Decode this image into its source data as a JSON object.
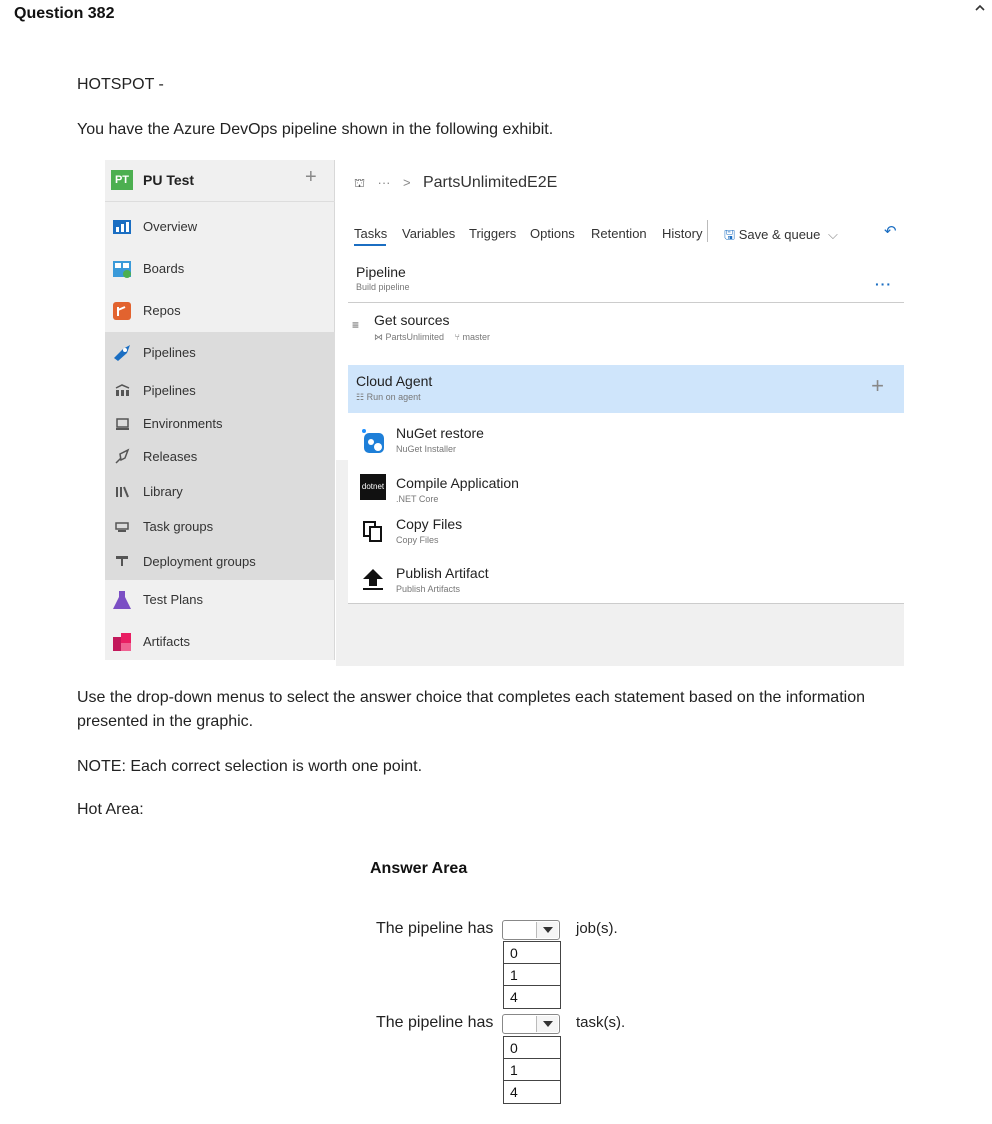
{
  "header": {
    "title": "Question 382",
    "collapse_icon": "chevron-up-icon"
  },
  "body": {
    "hotspot": "HOTSPOT -",
    "intro": "You have the Azure DevOps pipeline shown in the following exhibit.",
    "instructions": "Use the drop-down menus to select the answer choice that completes each statement based on the information presented in the graphic.",
    "note": "NOTE: Each correct selection is worth one point.",
    "hot_area": "Hot Area:"
  },
  "exhibit": {
    "sidebar": {
      "badge": "PT",
      "project": "PU Test",
      "plus": "+",
      "items": [
        {
          "label": "Overview",
          "icon": "overview-icon"
        },
        {
          "label": "Boards",
          "icon": "boards-icon"
        },
        {
          "label": "Repos",
          "icon": "repos-icon"
        },
        {
          "label": "Pipelines",
          "icon": "pipelines-icon"
        },
        {
          "label": "Pipelines",
          "icon": "pipelines-sub-icon"
        },
        {
          "label": "Environments",
          "icon": "environments-icon"
        },
        {
          "label": "Releases",
          "icon": "releases-icon"
        },
        {
          "label": "Library",
          "icon": "library-icon"
        },
        {
          "label": "Task groups",
          "icon": "task-groups-icon"
        },
        {
          "label": "Deployment groups",
          "icon": "deployment-groups-icon"
        },
        {
          "label": "Test Plans",
          "icon": "test-plans-icon"
        },
        {
          "label": "Artifacts",
          "icon": "artifacts-icon"
        }
      ]
    },
    "breadcrumb": {
      "dots": "···",
      "sep": ">",
      "name": "PartsUnlimitedE2E"
    },
    "tabs": [
      "Tasks",
      "Variables",
      "Triggers",
      "Options",
      "Retention",
      "History"
    ],
    "save_queue": "Save & queue",
    "pipeline": {
      "title": "Pipeline",
      "subtitle": "Build pipeline",
      "more": "···"
    },
    "get_sources": {
      "title": "Get sources",
      "repo": "PartsUnlimited",
      "branch": "master"
    },
    "agent": {
      "title": "Cloud Agent",
      "subtitle": "Run on agent",
      "plus": "+"
    },
    "tasks": [
      {
        "title": "NuGet restore",
        "subtitle": "NuGet Installer",
        "icon": "nuget-icon"
      },
      {
        "title": "Compile Application",
        "subtitle": ".NET Core",
        "icon": "dotnet-icon",
        "icon_text": "dotnet"
      },
      {
        "title": "Copy Files",
        "subtitle": "Copy Files",
        "icon": "copy-files-icon"
      },
      {
        "title": "Publish Artifact",
        "subtitle": "Publish Artifacts",
        "icon": "publish-icon"
      }
    ]
  },
  "answer_area": {
    "title": "Answer Area",
    "statements": [
      {
        "prefix": "The pipeline has",
        "suffix": "job(s).",
        "options": [
          "0",
          "1",
          "4"
        ],
        "selected": ""
      },
      {
        "prefix": "The pipeline has",
        "suffix": "task(s).",
        "options": [
          "0",
          "1",
          "4"
        ],
        "selected": ""
      }
    ]
  }
}
